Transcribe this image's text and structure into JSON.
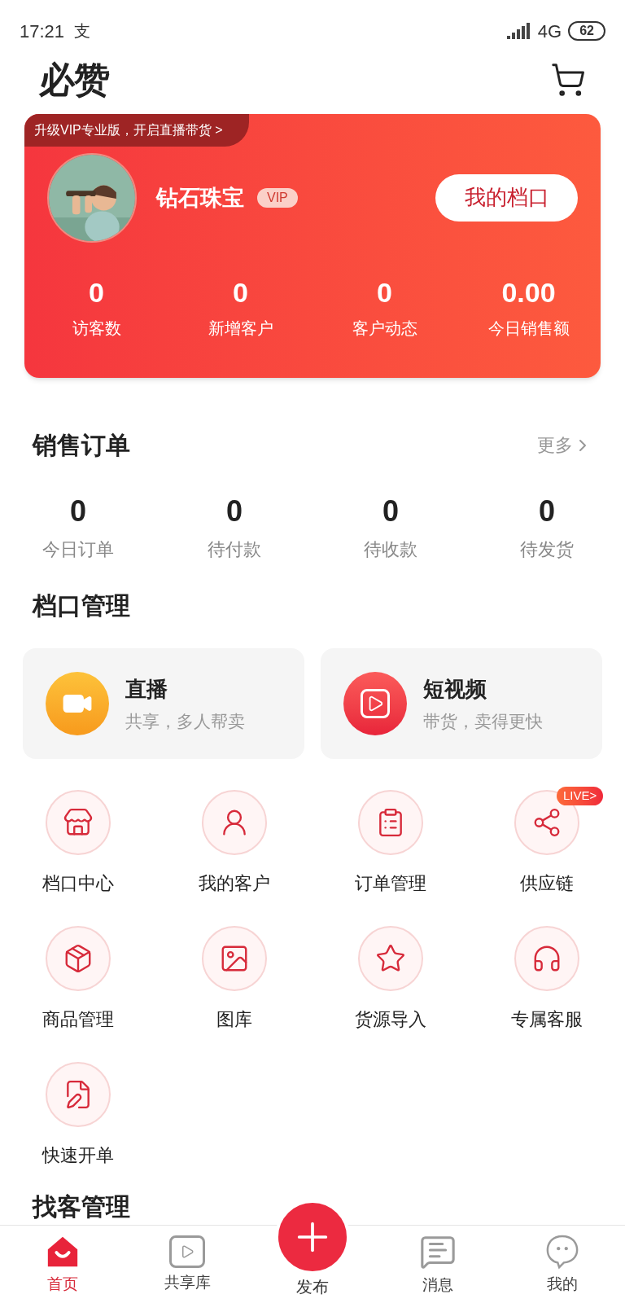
{
  "status_bar": {
    "time": "17:21",
    "notification": "支",
    "network": "4G",
    "battery": "62"
  },
  "header": {
    "logo": "必赞"
  },
  "profile_card": {
    "promo": "升级VIP专业版，开启直播带货 >",
    "name": "钻石珠宝",
    "badge": "VIP",
    "button": "我的档口",
    "stats": [
      {
        "value": "0",
        "label": "访客数"
      },
      {
        "value": "0",
        "label": "新增客户"
      },
      {
        "value": "0",
        "label": "客户动态"
      },
      {
        "value": "0.00",
        "label": "今日销售额"
      }
    ]
  },
  "sales_orders": {
    "title": "销售订单",
    "more": "更多",
    "stats": [
      {
        "value": "0",
        "label": "今日订单"
      },
      {
        "value": "0",
        "label": "待付款"
      },
      {
        "value": "0",
        "label": "待收款"
      },
      {
        "value": "0",
        "label": "待发货"
      }
    ]
  },
  "stall_management": {
    "title": "档口管理",
    "features": [
      {
        "kind": "live",
        "title": "直播",
        "subtitle": "共享，多人帮卖"
      },
      {
        "kind": "video",
        "title": "短视频",
        "subtitle": "带货，卖得更快"
      }
    ],
    "tools": [
      {
        "kind": "store",
        "label": "档口中心"
      },
      {
        "kind": "customer",
        "label": "我的客户"
      },
      {
        "kind": "orders",
        "label": "订单管理"
      },
      {
        "kind": "supply",
        "label": "供应链",
        "badge": "LIVE>"
      },
      {
        "kind": "product",
        "label": "商品管理"
      },
      {
        "kind": "gallery",
        "label": "图库"
      },
      {
        "kind": "import",
        "label": "货源导入"
      },
      {
        "kind": "service",
        "label": "专属客服"
      },
      {
        "kind": "quick",
        "label": "快速开单"
      }
    ]
  },
  "next_section": {
    "title": "找客管理"
  },
  "bottom_nav": [
    {
      "kind": "home",
      "label": "首页",
      "selected": true
    },
    {
      "kind": "library",
      "label": "共享库",
      "selected": false
    },
    {
      "kind": "publish",
      "label": "发布",
      "selected": false
    },
    {
      "kind": "messages",
      "label": "消息",
      "selected": false
    },
    {
      "kind": "me",
      "label": "我的",
      "selected": false
    }
  ]
}
